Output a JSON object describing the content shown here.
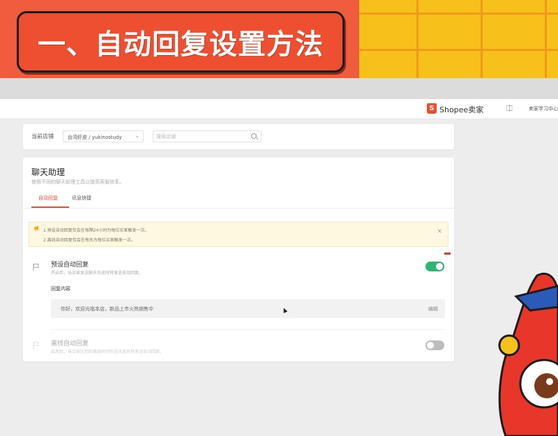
{
  "banner": {
    "title": "一、自动回复设置方法"
  },
  "topbar": {
    "logo_mark": "S",
    "brand": "Shopee卖家",
    "bell_icon": "bell-icon",
    "user": "卖家学习中心"
  },
  "shop_selector": {
    "label": "当前店铺",
    "selected": "台湾虾皮 / yukinostudy",
    "search_placeholder": "搜索店铺"
  },
  "panel": {
    "title": "聊天助理",
    "description": "使用不同的聊天助理工具以提高客服效率。",
    "tabs": [
      {
        "label": "自动回复",
        "active": true
      },
      {
        "label": "讯息快捷",
        "active": false
      }
    ]
  },
  "notice": {
    "line1": "1.预设自动回复仅会在每隔24小时为每位买家触发一次。",
    "line2": "2.离线自动回复仅会在每天为每位买家触发一次。",
    "close": "×"
  },
  "default_reply": {
    "title": "预设自动回复",
    "description": "开启后，当买家发送聊天讯息时将发送自动回复。",
    "enabled": true,
    "content_label": "回复内容",
    "content": "你好，欢迎光临本店，新品上市火热销售中",
    "edit": "编辑"
  },
  "offline_reply": {
    "title": "离线自动回复",
    "description": "启用后，当买家在您的离线时间传送讯息时将发送自动回复。",
    "enabled": false
  },
  "colors": {
    "brand": "#ee4d2d",
    "toggle_on": "#2bb673",
    "toggle_off": "#bdbdbd",
    "notice_bg": "#fff8e1"
  }
}
